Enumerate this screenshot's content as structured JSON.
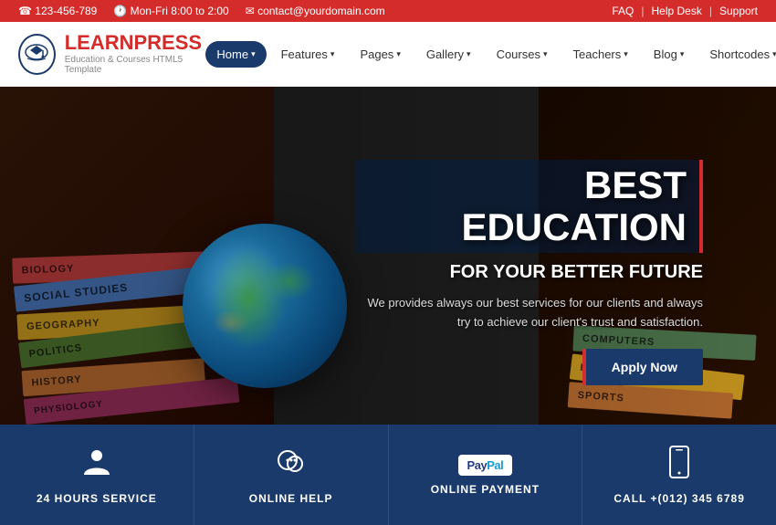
{
  "topbar": {
    "phone": "123-456-789",
    "hours": "Mon-Fri 8:00 to 2:00",
    "email": "contact@yourdomain.com",
    "links": [
      "FAQ",
      "Help Desk",
      "Support"
    ]
  },
  "header": {
    "logo_learn": "LEARN",
    "logo_press": "PRESS",
    "logo_tagline": "Education & Courses HTML5 Template",
    "nav": [
      {
        "label": "Home",
        "active": true
      },
      {
        "label": "Features",
        "active": false
      },
      {
        "label": "Pages",
        "active": false
      },
      {
        "label": "Gallery",
        "active": false
      },
      {
        "label": "Courses",
        "active": false
      },
      {
        "label": "Teachers",
        "active": false
      },
      {
        "label": "Blog",
        "active": false
      },
      {
        "label": "Shortcodes",
        "active": false
      }
    ]
  },
  "hero": {
    "title": "BEST EDUCATION",
    "subtitle": "FOR YOUR BETTER FUTURE",
    "description": "We provides always our best services for our clients and always\ntry to achieve our client's trust and satisfaction.",
    "cta": "Apply Now",
    "books_left": [
      "BIOLOGY",
      "SOCIAL STUDIES",
      "GEOGRAPHY",
      "POLITICS",
      "HISTORY",
      "PHYSIOLOGY"
    ],
    "books_right": [
      "COMPUTERS",
      "ENGLISH",
      "SPORTS"
    ]
  },
  "features": [
    {
      "icon": "person",
      "label": "24 HOURS SERVICE"
    },
    {
      "icon": "chat",
      "label": "ONLINE HELP"
    },
    {
      "icon": "paypal",
      "label": "ONLINE PAYMENT"
    },
    {
      "icon": "mobile",
      "label": "CALL +(012) 345 6789"
    }
  ]
}
